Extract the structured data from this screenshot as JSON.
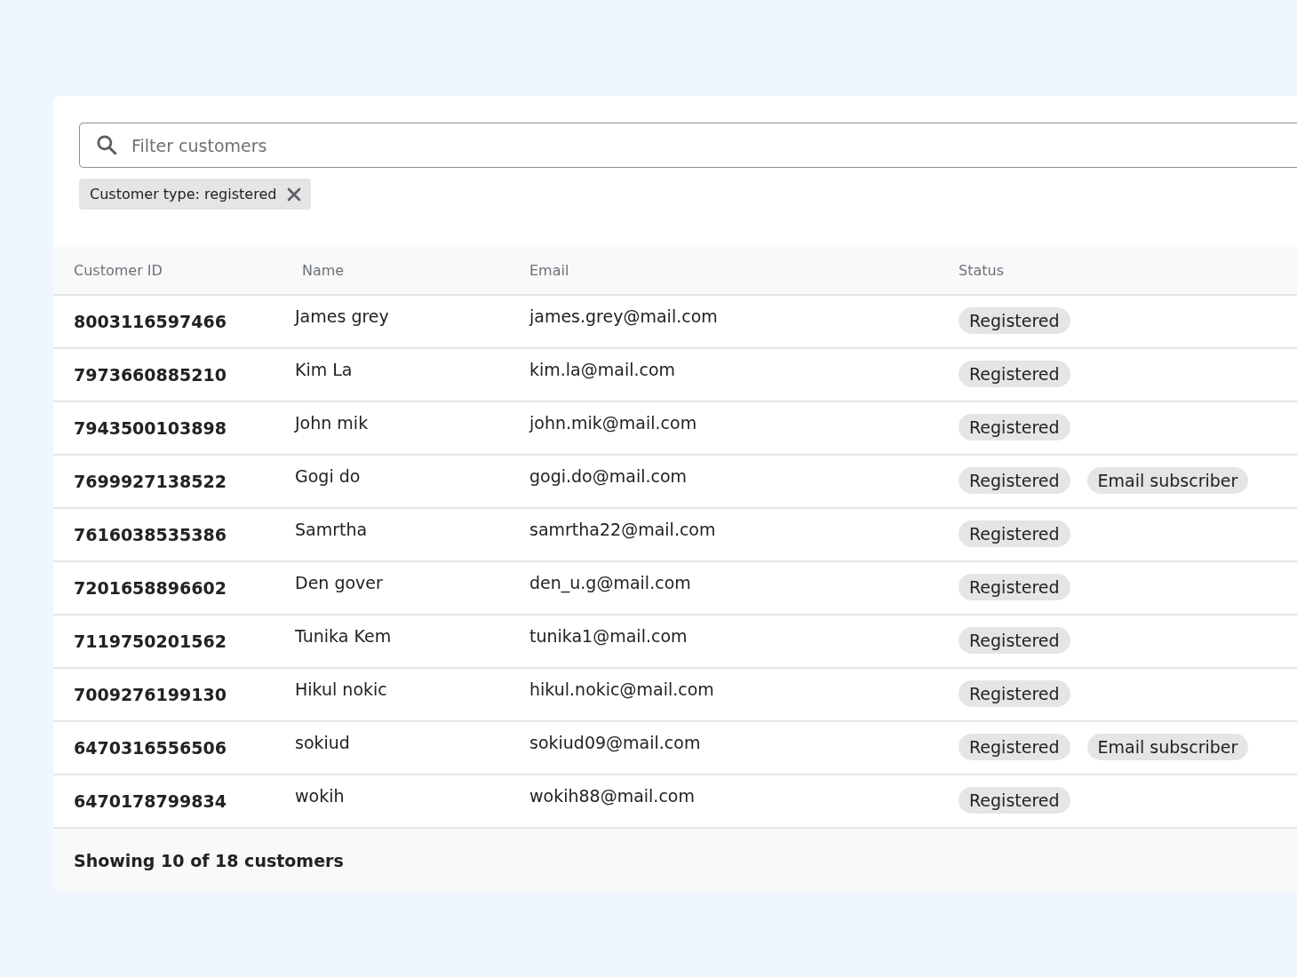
{
  "search": {
    "placeholder": "Filter customers"
  },
  "filters": [
    {
      "label": "Customer type: registered"
    }
  ],
  "table": {
    "columns": [
      "Customer ID",
      "Name",
      "Email",
      "Status"
    ],
    "rows": [
      {
        "id": "8003116597466",
        "name": "James grey",
        "email": "james.grey@mail.com",
        "tags": [
          "Registered"
        ]
      },
      {
        "id": "7973660885210",
        "name": "Kim La",
        "email": "kim.la@mail.com",
        "tags": [
          "Registered"
        ]
      },
      {
        "id": "7943500103898",
        "name": "John mik",
        "email": "john.mik@mail.com",
        "tags": [
          "Registered"
        ]
      },
      {
        "id": "7699927138522",
        "name": "Gogi do",
        "email": "gogi.do@mail.com",
        "tags": [
          "Registered",
          "Email subscriber"
        ]
      },
      {
        "id": "7616038535386",
        "name": "Samrtha",
        "email": "samrtha22@mail.com",
        "tags": [
          "Registered"
        ]
      },
      {
        "id": "7201658896602",
        "name": "Den gover",
        "email": "den_u.g@mail.com",
        "tags": [
          "Registered"
        ]
      },
      {
        "id": "7119750201562",
        "name": "Tunika Kem",
        "email": "tunika1@mail.com",
        "tags": [
          "Registered"
        ]
      },
      {
        "id": "7009276199130",
        "name": "Hikul nokic",
        "email": "hikul.nokic@mail.com",
        "tags": [
          "Registered"
        ]
      },
      {
        "id": "6470316556506",
        "name": "sokiud",
        "email": "sokiud09@mail.com",
        "tags": [
          "Registered",
          "Email subscriber"
        ]
      },
      {
        "id": "6470178799834",
        "name": "wokih",
        "email": "wokih88@mail.com",
        "tags": [
          "Registered"
        ]
      }
    ]
  },
  "footer": "Showing 10 of 18 customers"
}
